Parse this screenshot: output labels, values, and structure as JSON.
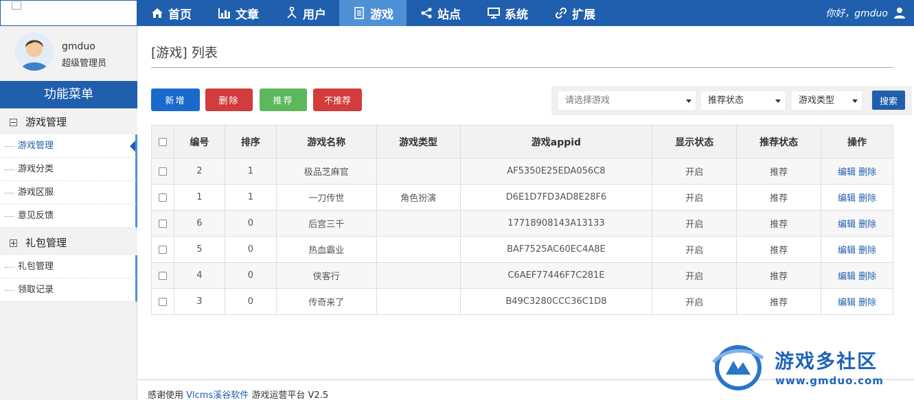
{
  "nav": {
    "items": [
      {
        "label": "首页",
        "icon": "home-icon"
      },
      {
        "label": "文章",
        "icon": "bar-chart-icon"
      },
      {
        "label": "用户",
        "icon": "user-tree-icon"
      },
      {
        "label": "游戏",
        "icon": "document-icon",
        "active": true
      },
      {
        "label": "站点",
        "icon": "share-icon"
      },
      {
        "label": "系统",
        "icon": "monitor-icon"
      },
      {
        "label": "扩展",
        "icon": "link-icon"
      }
    ],
    "greeting": "你好，gmduo"
  },
  "sidebar": {
    "username": "gmduo",
    "role": "超级管理员",
    "menu_title": "功能菜单",
    "groups": [
      {
        "label": "游戏管理",
        "items": [
          "游戏管理",
          "游戏分类",
          "游戏区服",
          "意见反馈"
        ]
      },
      {
        "label": "礼包管理",
        "items": [
          "礼包管理",
          "领取记录"
        ]
      }
    ]
  },
  "main": {
    "title": "[游戏] 列表",
    "buttons": {
      "new": "新增",
      "delete": "删除",
      "recommend": "推荐",
      "unrecommend": "不推荐"
    },
    "filter": {
      "game_placeholder": "请选择游戏",
      "recommend_status": "推荐状态",
      "game_type": "游戏类型",
      "search": "搜索"
    },
    "table": {
      "headers": [
        "编号",
        "排序",
        "游戏名称",
        "游戏类型",
        "游戏appid",
        "显示状态",
        "推荐状态",
        "操作"
      ],
      "rows": [
        {
          "id": "2",
          "order": "1",
          "name": "极品芝麻官",
          "type": "",
          "appid": "AF5350E25EDA056C8",
          "display": "开启",
          "recommend": "推荐"
        },
        {
          "id": "1",
          "order": "1",
          "name": "一刀传世",
          "type": "角色扮演",
          "appid": "D6E1D7FD3AD8E28F6",
          "display": "开启",
          "recommend": "推荐"
        },
        {
          "id": "6",
          "order": "0",
          "name": "后宫三千",
          "type": "",
          "appid": "17718908143A13133",
          "display": "开启",
          "recommend": "推荐"
        },
        {
          "id": "5",
          "order": "0",
          "name": "热血霸业",
          "type": "",
          "appid": "BAF7525AC60EC4A8E",
          "display": "开启",
          "recommend": "推荐"
        },
        {
          "id": "4",
          "order": "0",
          "name": "侠客行",
          "type": "",
          "appid": "C6AEF77446F7C281E",
          "display": "开启",
          "recommend": "推荐"
        },
        {
          "id": "3",
          "order": "0",
          "name": "传奇来了",
          "type": "",
          "appid": "B49C3280CCC36C1D8",
          "display": "开启",
          "recommend": "推荐"
        }
      ],
      "edit_label": "编辑",
      "delete_label": "删除"
    }
  },
  "footer": {
    "prefix": "感谢使用",
    "link": "Vlcms溪谷软件",
    "suffix": "游戏运营平台 V2.5"
  },
  "watermark": {
    "title": "游戏多社区",
    "url": "www.gmduo.com"
  }
}
